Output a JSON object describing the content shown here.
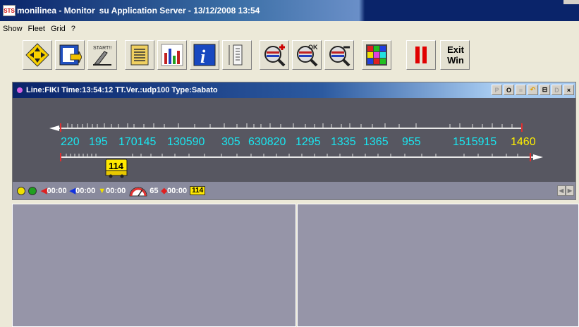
{
  "window": {
    "title_app": "monilinea - Monitor",
    "title_rest": "su Application Server   - 13/12/2008 13:54",
    "icon_text": "STS"
  },
  "menu": [
    "Show",
    "Fleet",
    "Grid",
    "?"
  ],
  "toolbar": {
    "buttons": [
      "navigate-icon",
      "document-export-icon",
      "start-icon",
      "schedule-icon",
      "bar-chart-icon",
      "info-icon",
      "timetable-icon",
      "zoom-in-icon",
      "zoom-ok-icon",
      "zoom-out-icon",
      "grid-color-icon",
      "pause-icon"
    ],
    "start_label": "START!!",
    "ok_label": "OK",
    "info_label": "i",
    "exit_line1": "Exit",
    "exit_line2": "Win"
  },
  "child_window": {
    "title": "Line:FIKI Time:13:54:12 TT.Ver.:udp100 Type:Sabato",
    "ctrl_p": "P",
    "ctrl_o": "O",
    "ctrl_d": "D",
    "ctrl_close": "×"
  },
  "line": {
    "labels_cyan": [
      "220",
      "195",
      "170145",
      "130590",
      "305",
      "630820",
      "1295",
      "1335",
      "1365",
      "955",
      "1515915"
    ],
    "label_yellow": "1460",
    "vehicle": "114",
    "accent_cyan": "#19e6f0",
    "accent_yellow": "#fff000"
  },
  "status": {
    "t1": "00:00",
    "t2": "00:00",
    "t3": "00:00",
    "speed": "65",
    "t4": "00:00",
    "vehicle": "114"
  }
}
